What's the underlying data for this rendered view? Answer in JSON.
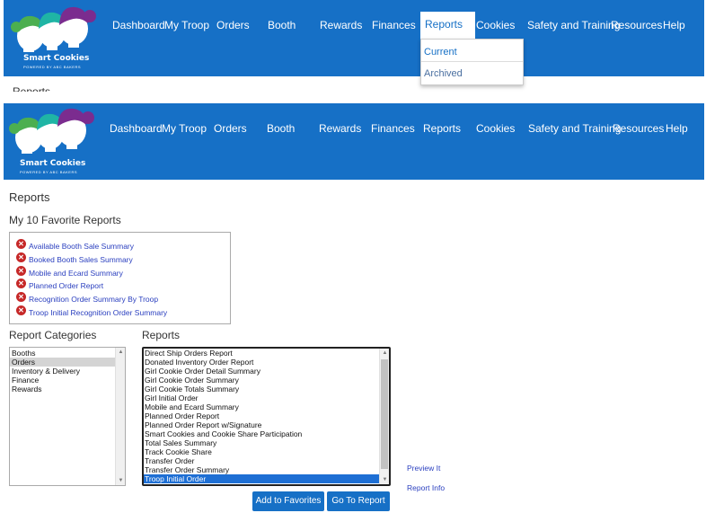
{
  "brand": {
    "logo_text": "Smart Cookies",
    "logo_subtext": "POWERED BY ABC BAKERS",
    "logo_tm": "TM",
    "colors": {
      "nav_bg": "#1670c6",
      "cookie_green": "#4caf50",
      "cookie_teal": "#1fb5a5",
      "cookie_purple": "#7b2c8f"
    }
  },
  "nav": {
    "items": [
      "Dashboard",
      "My Troop",
      "Orders",
      "Booth",
      "Rewards",
      "Finances",
      "Reports",
      "Cookies",
      "Safety and Training",
      "Resources",
      "Help"
    ]
  },
  "reports_menu": {
    "current": "Current",
    "archived": "Archived"
  },
  "cut_text": "Reports",
  "page": {
    "title": "Reports",
    "favorites_title": "My 10 Favorite Reports",
    "favorites": [
      "Available Booth Sale Summary",
      "Booked Booth Sales Summary",
      "Mobile and Ecard Summary",
      "Planned Order Report",
      "Recognition Order Summary By Troop",
      "Troop Initial Recognition Order Summary"
    ],
    "categories_label": "Report Categories",
    "categories": [
      "Booths",
      "Orders",
      "Inventory & Delivery",
      "Finance",
      "Rewards"
    ],
    "selected_category": "Orders",
    "reports_label": "Reports",
    "reports": [
      "Direct Ship Orders Report",
      "Donated Inventory Order Report",
      "Girl Cookie Order Detail Summary",
      "Girl Cookie Order Summary",
      "Girl Cookie Totals Summary",
      "Girl Initial Order",
      "Mobile and Ecard Summary",
      "Planned Order Report",
      "Planned Order Report w/Signature",
      "Smart Cookies and Cookie Share Participation",
      "Total Sales Summary",
      "Track Cookie Share",
      "Transfer Order",
      "Transfer Order Summary",
      "Troop Initial Order"
    ],
    "selected_report": "Troop Initial Order",
    "preview_link": "Preview It",
    "info_link": "Report Info",
    "add_favorites_button": "Add to Favorites",
    "goto_report_button": "Go To Report"
  }
}
